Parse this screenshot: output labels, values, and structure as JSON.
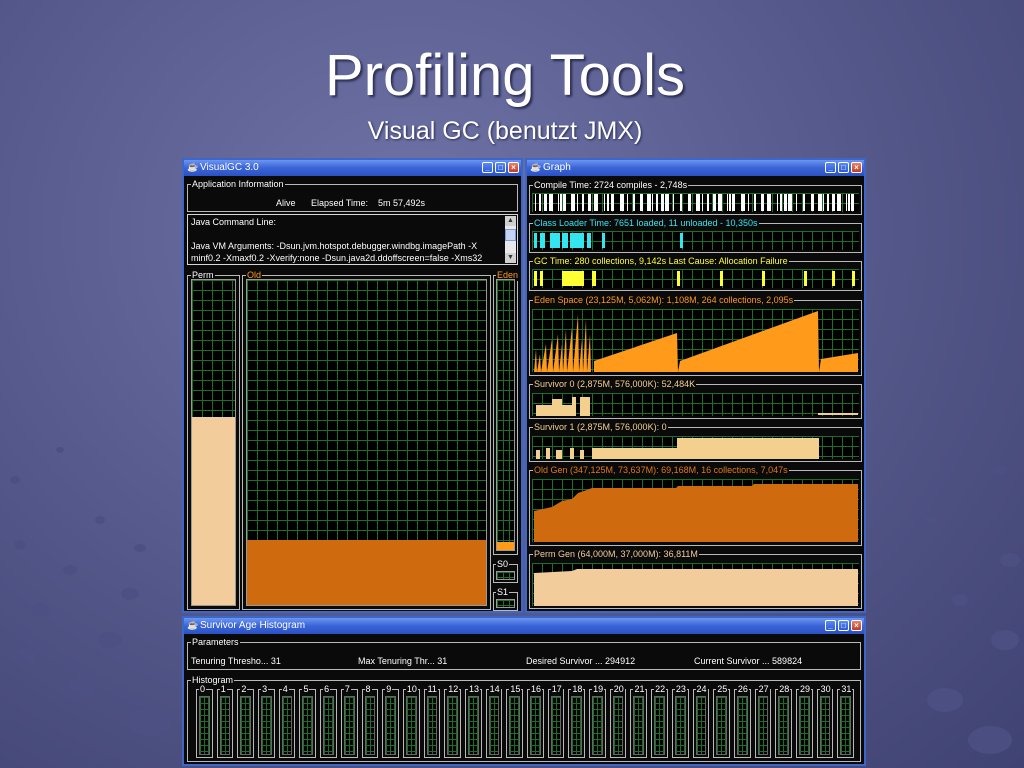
{
  "slide": {
    "title": "Profiling Tools",
    "subtitle": "Visual GC (benutzt JMX)"
  },
  "visualgc": {
    "window_title": "VisualGC 3.0",
    "app_info_label": "Application Information",
    "status": "Alive",
    "elapsed_label": "Elapsed Time:",
    "elapsed_value": "5m 57,492s",
    "cmdline_label": "Java Command Line:",
    "vm_args_line1": "Java VM Arguments: -Dsun.jvm.hotspot.debugger.windbg.imagePath -X",
    "vm_args_line2": "minf0.2 -Xmaxf0.2 -Xverify:none -Dsun.java2d.ddoffscreen=false -Xms32",
    "perm_label": "Perm",
    "old_label": "Old",
    "eden_label": "Eden",
    "s0_label": "S0",
    "s1_label": "S1",
    "perm_fill": 0.58,
    "old_fill": 0.2,
    "eden_fill": 0.03
  },
  "graph": {
    "window_title": "Graph",
    "panels": [
      {
        "label": "Compile Time: 2724 compiles - 2,748s",
        "color": "#ffffff"
      },
      {
        "label": "Class Loader Time: 7651 loaded, 11 unloaded - 10,350s",
        "color": "#33e6f0"
      },
      {
        "label": "GC Time: 280 collections, 9,142s  Last Cause: Allocation Failure",
        "color": "#ffff33"
      },
      {
        "label": "Eden Space (23,125M, 5,062M): 1,108M, 264 collections, 2,095s",
        "color": "#ff9a1a"
      },
      {
        "label": "Survivor 0 (2,875M, 576,000K): 52,484K",
        "color": "#f4d08e"
      },
      {
        "label": "Survivor 1 (2,875M, 576,000K): 0",
        "color": "#f4d08e"
      },
      {
        "label": "Old Gen (347,125M, 73,637M): 69,168M, 16 collections, 7,047s",
        "color": "#e07818"
      },
      {
        "label": "Perm Gen (64,000M, 37,000M): 36,811M",
        "color": "#f2cc9a"
      }
    ]
  },
  "histogram": {
    "window_title": "Survivor Age Histogram",
    "params_label": "Parameters",
    "params": [
      {
        "label": "Tenuring Thresho...",
        "value": "31"
      },
      {
        "label": "Max Tenuring Thr...",
        "value": "31"
      },
      {
        "label": "Desired Survivor ...",
        "value": "294912"
      },
      {
        "label": "Current Survivor ...",
        "value": "589824"
      }
    ],
    "histogram_label": "Histogram",
    "ages": [
      "0",
      "1",
      "2",
      "3",
      "4",
      "5",
      "6",
      "7",
      "8",
      "9",
      "10",
      "11",
      "12",
      "13",
      "14",
      "15",
      "16",
      "17",
      "18",
      "19",
      "20",
      "21",
      "22",
      "23",
      "24",
      "25",
      "26",
      "27",
      "28",
      "29",
      "30",
      "31"
    ]
  },
  "colors": {
    "accent_blue": "#3d66c9",
    "grid_green": "#1e6d28",
    "perm_fill": "#f2cc9a",
    "old_fill": "#cf6a0e"
  }
}
